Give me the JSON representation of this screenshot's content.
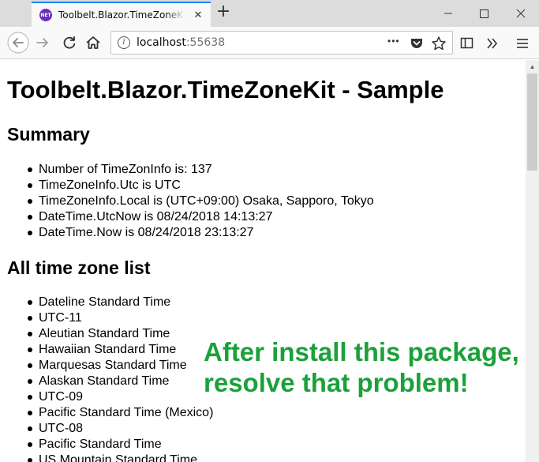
{
  "browser": {
    "tab": {
      "favicon_text": "NET",
      "title": "Toolbelt.Blazor.TimeZoneKit - Sample",
      "close_glyph": "✕"
    },
    "new_tab_glyph": "+",
    "window_controls": {
      "minimize": "—",
      "maximize": "☐",
      "close": "✕"
    },
    "nav": {
      "back_icon": "back-arrow-icon",
      "forward_icon": "forward-arrow-icon",
      "reload_icon": "reload-icon",
      "home_icon": "home-icon"
    },
    "url": {
      "host": "localhost",
      "port": ":55638"
    },
    "url_actions": {
      "more_glyph": "•••"
    }
  },
  "page": {
    "title": "Toolbelt.Blazor.TimeZoneKit - Sample",
    "summary": {
      "heading": "Summary",
      "items": [
        "Number of TimeZonInfo is: 137",
        "TimeZoneInfo.Utc is UTC",
        "TimeZoneInfo.Local is (UTC+09:00) Osaka, Sapporo, Tokyo",
        "DateTime.UtcNow is 08/24/2018 14:13:27",
        "DateTime.Now is 08/24/2018 23:13:27"
      ]
    },
    "timezones": {
      "heading": "All time zone list",
      "items": [
        "Dateline Standard Time",
        "UTC-11",
        "Aleutian Standard Time",
        "Hawaiian Standard Time",
        "Marquesas Standard Time",
        "Alaskan Standard Time",
        "UTC-09",
        "Pacific Standard Time (Mexico)",
        "UTC-08",
        "Pacific Standard Time",
        "US Mountain Standard Time"
      ]
    }
  },
  "overlay": {
    "line1": "After install this package,",
    "line2": "resolve that problem!"
  },
  "colors": {
    "accent": "#0a84ff",
    "overlay_text": "#1aa13a"
  }
}
